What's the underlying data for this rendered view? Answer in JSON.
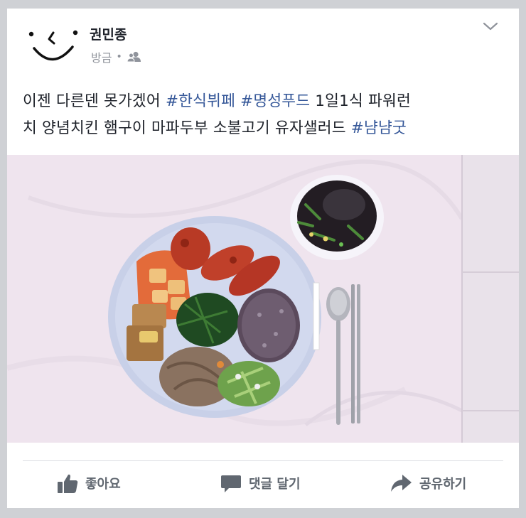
{
  "post": {
    "author": "권민종",
    "time": "방금",
    "privacy_icon": "friends-icon",
    "menu_icon": "chevron-down-icon",
    "text_line1": [
      {
        "text": "이젠 다른덴 못가겠어 ",
        "hashtag": false
      },
      {
        "text": "#한식뷔페",
        "hashtag": true
      },
      {
        "text": " ",
        "hashtag": false
      },
      {
        "text": "#명성푸드",
        "hashtag": true
      },
      {
        "text": " 1일1식 파워런",
        "hashtag": false
      }
    ],
    "text_line2": [
      {
        "text": "치 양념치킨 햄구이 마파두부 소불고기 유자샐러드 ",
        "hashtag": false
      },
      {
        "text": "#냠냠굿",
        "hashtag": true
      }
    ],
    "photo": "food-photo"
  },
  "actions": {
    "like_label": "좋아요",
    "comment_label": "댓글 달기",
    "share_label": "공유하기"
  },
  "colors": {
    "hashtag": "#365899",
    "text": "#1d2129",
    "muted": "#90949c",
    "action": "#606770"
  }
}
